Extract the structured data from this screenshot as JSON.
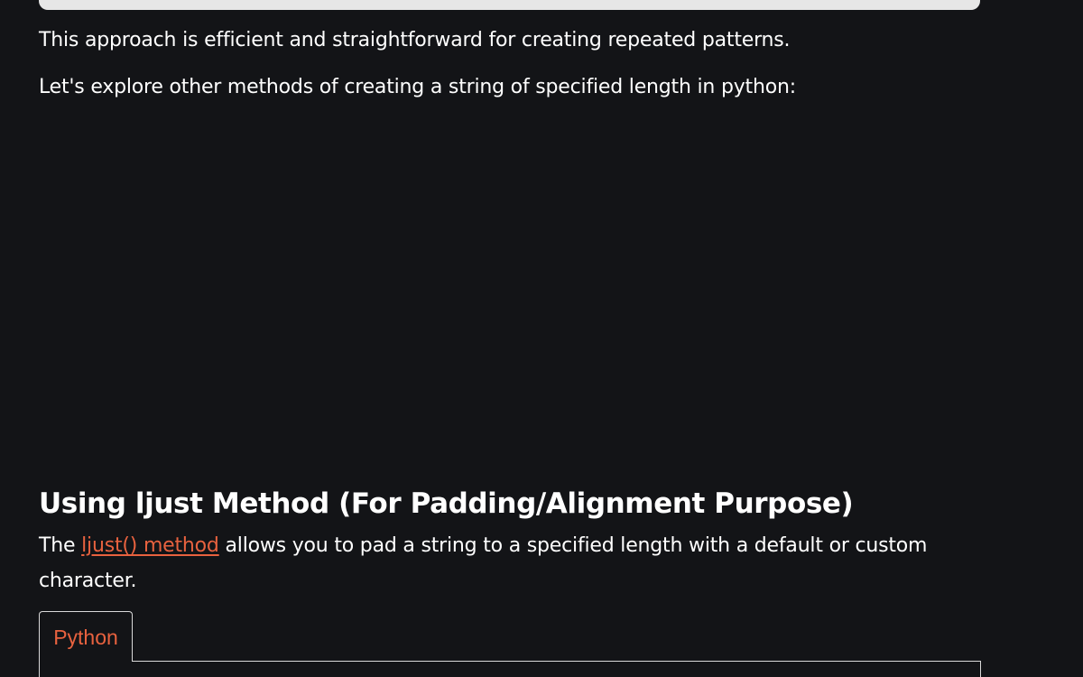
{
  "article": {
    "paragraph_1": "This approach is efficient and straightforward for creating repeated patterns.",
    "paragraph_2": "Let's explore other methods of creating a string of specified length in python:",
    "section_heading": "Using ljust Method (For Padding/Alignment Purpose)",
    "paragraph_3": {
      "prefix": "The ",
      "link_text": "ljust() method",
      "suffix": " allows you to pad a string to a specified length with a default or custom character."
    }
  },
  "code_tabs": {
    "active_tab_label": "Python"
  },
  "colors": {
    "background": "#131417",
    "text": "#ffffff",
    "link_accent": "#e8623f",
    "border": "#d9d9d9",
    "code_block_bg": "#e6e6e6"
  }
}
